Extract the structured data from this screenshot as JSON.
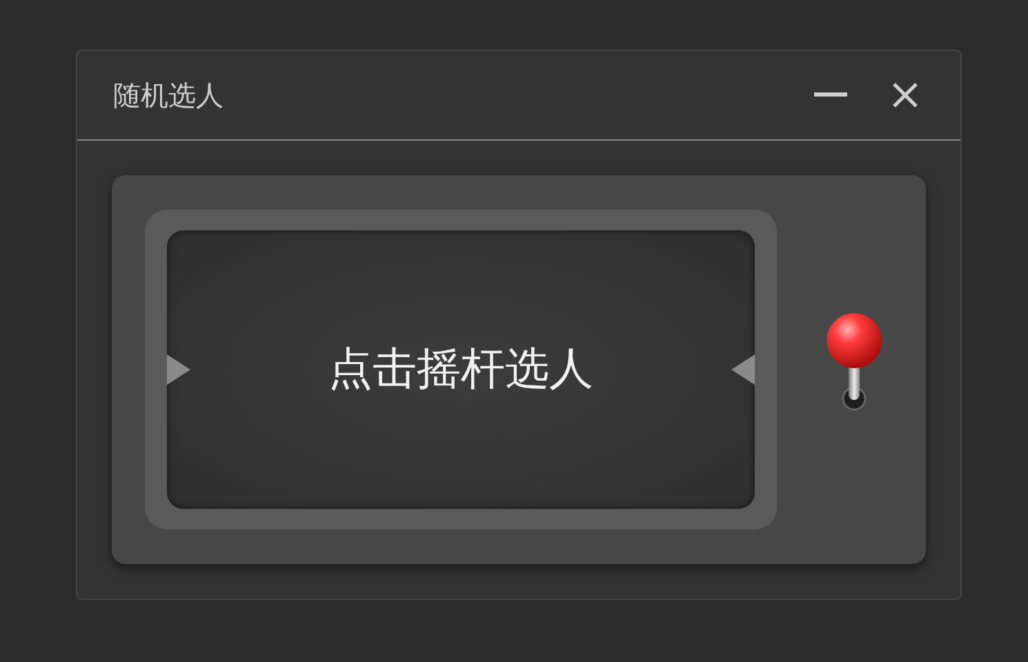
{
  "window": {
    "title": "随机选人"
  },
  "display": {
    "text": "点击摇杆选人"
  }
}
